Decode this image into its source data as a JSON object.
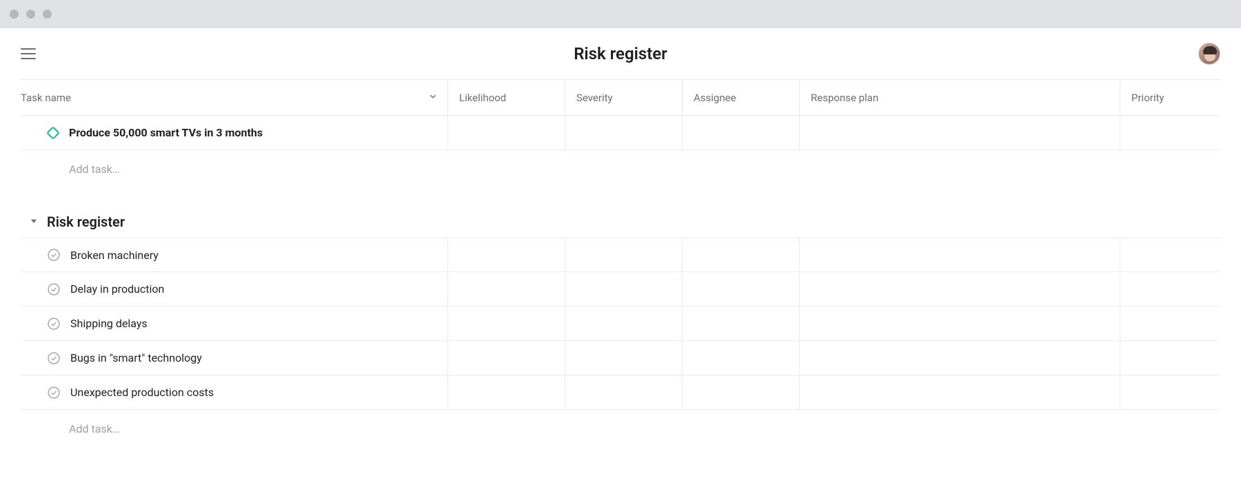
{
  "window": {
    "page_title": "Risk register"
  },
  "columns": {
    "task_name": "Task name",
    "likelihood": "Likelihood",
    "severity": "Severity",
    "assignee": "Assignee",
    "response_plan": "Response plan",
    "priority": "Priority"
  },
  "milestone": {
    "name": "Produce 50,000 smart TVs in 3 months"
  },
  "add_task_label": "Add task…",
  "section": {
    "title": "Risk register",
    "items": [
      {
        "name": "Broken machinery"
      },
      {
        "name": "Delay in production"
      },
      {
        "name": "Shipping delays"
      },
      {
        "name": "Bugs in \"smart\" technology"
      },
      {
        "name": "Unexpected production costs"
      }
    ]
  }
}
